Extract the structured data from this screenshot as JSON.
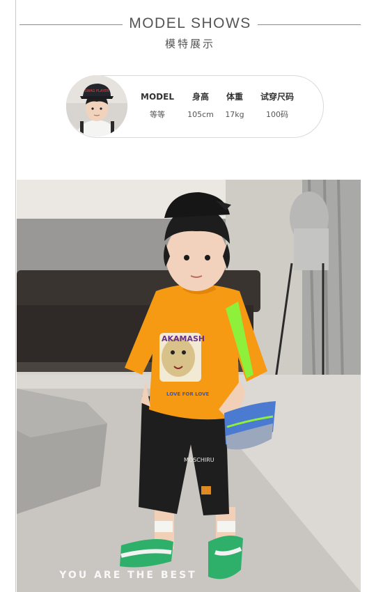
{
  "header": {
    "title": "MODEL SHOWS",
    "subtitle": "模特展示"
  },
  "model_card": {
    "stats": [
      {
        "label": "MODEL",
        "value": "等等"
      },
      {
        "label": "身高",
        "value": "105cm"
      },
      {
        "label": "体重",
        "value": "17kg"
      },
      {
        "label": "试穿尺码",
        "value": "100码"
      }
    ]
  },
  "photo": {
    "shirt_text": "AKAMASH",
    "shirt_subtext": "LOVE FOR LOVE",
    "shorts_text": "MOSCHIRU",
    "cap_text": "SWAG PLAYER",
    "tagline": "YOU ARE THE BEST"
  },
  "colors": {
    "shirt": "#f59a12",
    "shorts": "#1e1e1e",
    "bag": "#4a7bd0",
    "strap": "#8ef03a",
    "sofa": "#3a3431"
  }
}
